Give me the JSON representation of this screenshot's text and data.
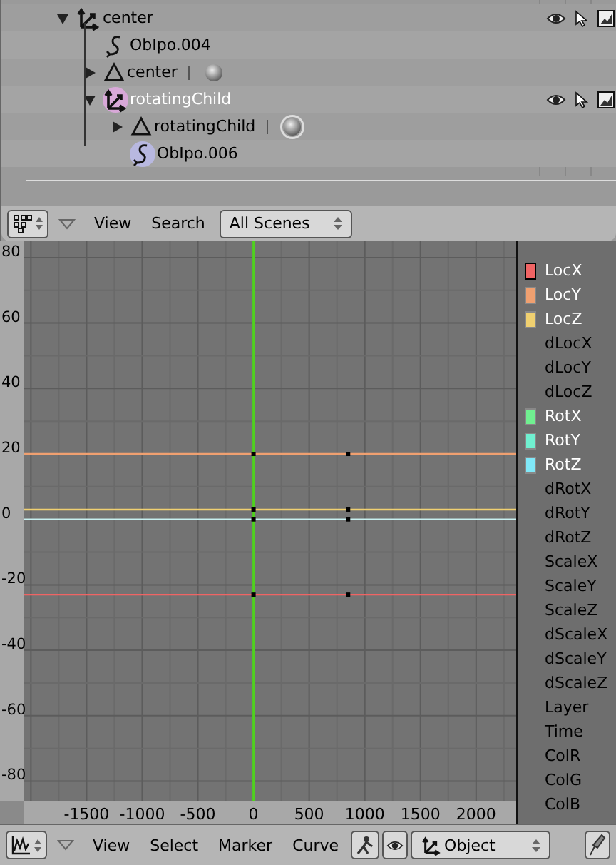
{
  "outliner": {
    "items": [
      {
        "kind": "object",
        "label": "center",
        "expanded": true,
        "selected": false,
        "children": [
          {
            "kind": "ipo",
            "label": "ObIpo.004",
            "selected": false
          },
          {
            "kind": "mesh",
            "label": "center",
            "expanded": false,
            "selected": false
          },
          {
            "kind": "object",
            "label": "rotatingChild",
            "expanded": true,
            "selected": true,
            "children": [
              {
                "kind": "mesh",
                "label": "rotatingChild",
                "expanded": false,
                "selected": true
              },
              {
                "kind": "ipo",
                "label": "ObIpo.006",
                "selected": true
              }
            ]
          }
        ]
      }
    ]
  },
  "outliner_header": {
    "menus": [
      "View",
      "Search"
    ],
    "scene_dropdown": "All Scenes"
  },
  "ipo_editor": {
    "chart_data": {
      "type": "line",
      "grid": true,
      "x": [
        -2060,
        0,
        850,
        2360
      ],
      "xlim": [
        -2060,
        2360
      ],
      "ylim": [
        -86,
        85
      ],
      "xticks": [
        -1500,
        -1000,
        -500,
        0,
        500,
        1000,
        1500,
        2000
      ],
      "yticks": [
        80,
        60,
        40,
        20,
        0,
        -20,
        -40,
        -60,
        -80
      ],
      "series": [
        {
          "color": "#f06464",
          "marker": "square",
          "values": [
            -23,
            -23,
            -23,
            -23
          ]
        },
        {
          "color": "#f0a070",
          "marker": "square",
          "values": [
            20,
            20,
            20,
            20
          ]
        },
        {
          "color": "#f0d070",
          "marker": "square",
          "values": [
            3,
            3,
            3,
            3
          ]
        },
        {
          "color": "#c8f0f0",
          "marker": "square",
          "values": [
            0,
            0,
            0,
            0
          ]
        }
      ],
      "ref_lines": [
        {
          "axis": "x",
          "value": 0,
          "color": "#50d020"
        }
      ]
    },
    "channels": [
      {
        "label": "LocX",
        "color": "#f06464",
        "selected": true
      },
      {
        "label": "LocY",
        "color": "#f0a070",
        "selected": false
      },
      {
        "label": "LocZ",
        "color": "#f0d070",
        "selected": false
      },
      {
        "label": "dLocX"
      },
      {
        "label": "dLocY"
      },
      {
        "label": "dLocZ"
      },
      {
        "label": "RotX",
        "color": "#70f090",
        "selected": false
      },
      {
        "label": "RotY",
        "color": "#70f0d0",
        "selected": false
      },
      {
        "label": "RotZ",
        "color": "#80e8f8",
        "selected": false
      },
      {
        "label": "dRotX"
      },
      {
        "label": "dRotY"
      },
      {
        "label": "dRotZ"
      },
      {
        "label": "ScaleX"
      },
      {
        "label": "ScaleY"
      },
      {
        "label": "ScaleZ"
      },
      {
        "label": "dScaleX"
      },
      {
        "label": "dScaleY"
      },
      {
        "label": "dScaleZ"
      },
      {
        "label": "Layer"
      },
      {
        "label": "Time"
      },
      {
        "label": "ColR"
      },
      {
        "label": "ColG"
      },
      {
        "label": "ColB"
      }
    ]
  },
  "ipo_header": {
    "menus": [
      "View",
      "Select",
      "Marker",
      "Curve"
    ],
    "type_dropdown": "Object"
  }
}
